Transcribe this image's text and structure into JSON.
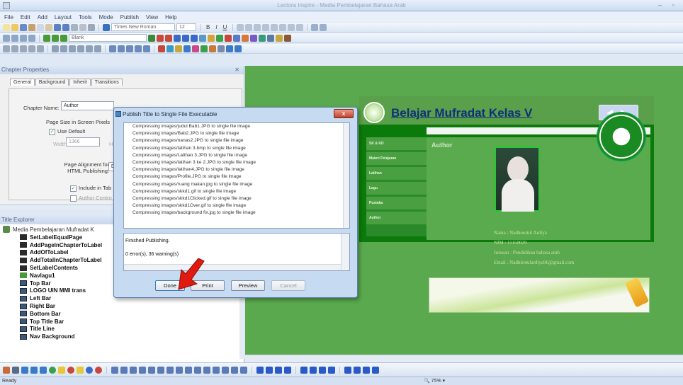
{
  "window": {
    "title": "Lectora Inspire - Media Pembelajaran Bahasa Arab"
  },
  "menu": [
    "File",
    "Edit",
    "Add",
    "Layout",
    "Tools",
    "Mode",
    "Publish",
    "View",
    "Help"
  ],
  "toolbar": {
    "font_family": "Times New Roman",
    "font_size": "12",
    "layout_select": "Blank"
  },
  "properties_panel": {
    "title": "Chapter Properties",
    "tabs": [
      "General",
      "Background",
      "Inherit",
      "Transitions"
    ],
    "chapter_name_label": "Chapter Name:",
    "chapter_name_value": "Author",
    "page_size_label": "Page Size in Screen Pixels",
    "use_default_label": "Use Default",
    "width_label": "Width:",
    "width_value": "1366",
    "height_label_partial": "H",
    "page_alignment_label": "Page Alignment for HTML Publishing:",
    "page_alignment_value": "D",
    "include_label": "Include in Tab",
    "author_control_label": "Author Contro"
  },
  "explorer": {
    "title": "Title Explorer",
    "root": "Media Pembelajaran Mufradat K",
    "items": [
      "SetLabelEqualPage",
      "AddPageInChapterToLabel",
      "AddOfToLabel",
      "AddTotalInChapterToLabel",
      "SetLabelContents",
      "Navlagu1",
      "Top Bar",
      "LOGO UIN MMI trans",
      "Left Bar",
      "Right Bar",
      "Bottom Bar",
      "Top Title Bar",
      "Title Line",
      "Nav Background"
    ]
  },
  "stage": {
    "title": "Belajar Mufradat Kelas V",
    "page_label": "Page",
    "content_heading": "Author",
    "nav_items": [
      "SK & KD",
      "Materi Pelajaran",
      "Latihan",
      "Lagu",
      "Pustaka",
      "Author"
    ],
    "info": [
      "Nama   : Nadhorotul Ardiya",
      "NIM   : 11150029",
      "Jurusan    : Pendidikan bahasa arab",
      "Email  : Nadhirotulardiya96@gmail.com"
    ]
  },
  "dialog": {
    "title": "Publish Title to Single File Executable",
    "close_label": "x",
    "log_lines": [
      "Compressing images/judul Bab1.JPG to single file image",
      "Compressing images/Bab2.JPG to single file image",
      "Compressing images/nanas2.JPG to single file image",
      "Compressing images/latihan 3.bmp to single file image",
      "Compressing images/Latihan 3.JPG to single file image",
      "Compressing images/latihan 3 ke 2.JPG to single file image",
      "Compressing images/latihan4.JPG to single file image",
      "Compressing images/Profile.JPG to single file image",
      "Compressing images/ruang makan.jpg to single file image",
      "Compressing images/skkd1.gif to single file image",
      "Compressing images/skkd1Clicked.gif to single file image",
      "Compressing images/skkd1Over.gif to single file image",
      "Compressing images/background fix.jpg to single file image"
    ],
    "status_lines": [
      "Finished Publishing.",
      "0 error(s), 36 warning(s)"
    ],
    "buttons": {
      "done": "Done",
      "print": "Print",
      "preview": "Preview",
      "cancel": "Cancel"
    }
  },
  "statusbar": {
    "text": "Ready",
    "zoom": "75%"
  }
}
